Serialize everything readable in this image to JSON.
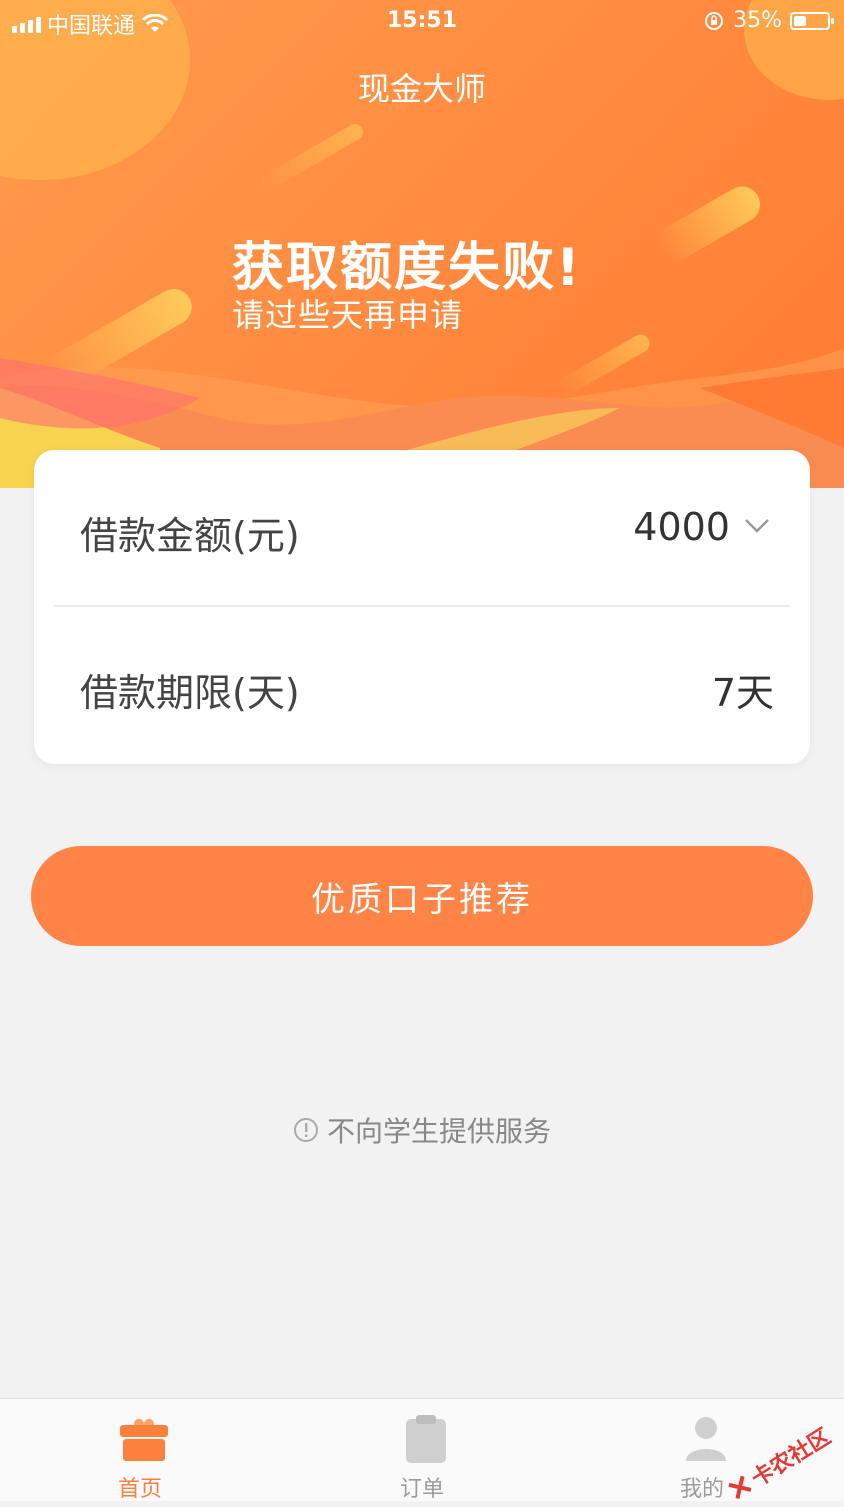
{
  "status_bar": {
    "carrier": "中国联通",
    "time": "15:51",
    "battery": "35%"
  },
  "header": {
    "app_title": "现金大师",
    "fail_title": "获取额度失败!",
    "fail_subtitle": "请过些天再申请"
  },
  "loan_form": {
    "amount_label": "借款金额(元)",
    "amount_value": "4000",
    "term_label": "借款期限(天)",
    "term_value": "7天"
  },
  "recommend_button": "优质口子推荐",
  "notice": "不向学生提供服务",
  "tabs": [
    {
      "label": "首页",
      "icon": "gift-box-icon",
      "active": true
    },
    {
      "label": "订单",
      "icon": "clipboard-icon",
      "active": false
    },
    {
      "label": "我的",
      "icon": "user-icon",
      "active": false
    }
  ],
  "watermark": "卡农社区",
  "colors": {
    "accent": "#ff8446",
    "tab_active": "#ff7f3c",
    "tab_inactive": "#9c9c9c"
  }
}
